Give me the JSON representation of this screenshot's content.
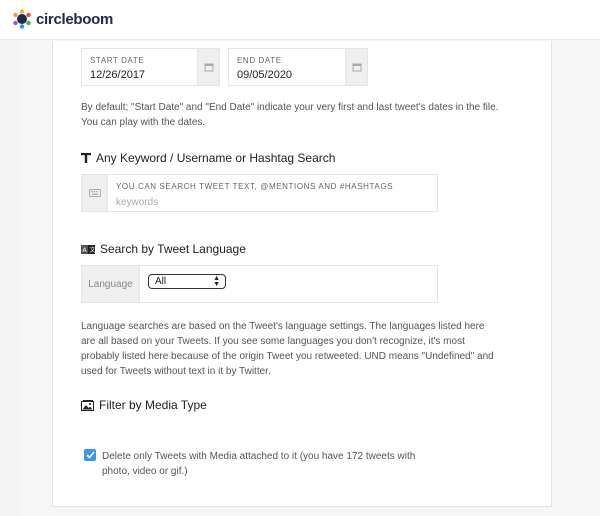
{
  "header": {
    "brand": "circleboom"
  },
  "dates": {
    "start_label": "START DATE",
    "start_value": "12/26/2017",
    "end_label": "END DATE",
    "end_value": "09/05/2020",
    "help": "By default; \"Start Date\" and \"End Date\" indicate your very first and last tweet's dates in the file. You can play with the dates."
  },
  "keyword": {
    "title": "Any Keyword / Username or Hashtag Search",
    "label": "YOU CAN SEARCH TWEET TEXT, @MENTIONS AND #HASHTAGS",
    "value": "",
    "placeholder": "keywords"
  },
  "language": {
    "title": "Search by Tweet Language",
    "field_label": "Language",
    "selected": "All",
    "help": "Language searches are based on the Tweet's language settings. The languages listed here are all based on your Tweets. If you see some languages you don't recognize, it's most probably listed here because of the origin Tweet you retweeted. UND means \"Undefined\" and used for Tweets without text in it by Twitter."
  },
  "media": {
    "title": "Filter by Media Type",
    "checkbox_label": "Delete only Tweets with Media attached to it (you have 172 tweets with photo, video or gif.)",
    "checked": true
  },
  "colors": {
    "accent": "#3b97e3",
    "brand": "#1d2a4b"
  }
}
